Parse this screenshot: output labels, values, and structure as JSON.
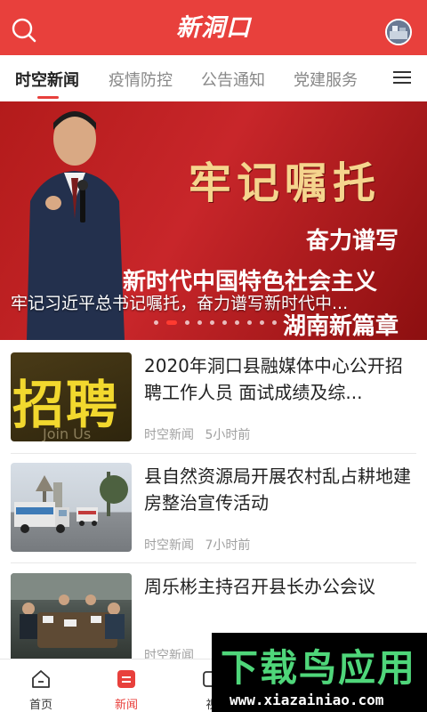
{
  "header": {
    "logo": "新洞口",
    "search_icon": "search-icon",
    "avatar_icon": "avatar"
  },
  "tabs": [
    {
      "label": "时空新闻",
      "active": true
    },
    {
      "label": "疫情防控"
    },
    {
      "label": "公告通知"
    },
    {
      "label": "党建服务"
    }
  ],
  "banner": {
    "headline": "牢记嘱托",
    "subline": "奋力谱写",
    "line2": "新时代中国特色社会主义",
    "line3": "湖南新篇章",
    "caption": "牢记习近平总书记嘱托，奋力谱写新时代中...",
    "dot_count": 10,
    "active_dot": 1
  },
  "news": [
    {
      "title": "2020年洞口县融媒体中心公开招聘工作人员 面试成绩及综...",
      "source": "时空新闻",
      "time": "5小时前",
      "thumb_text": "招聘",
      "thumb_sub": "Join Us"
    },
    {
      "title": "县自然资源局开展农村乱占耕地建房整治宣传活动",
      "source": "时空新闻",
      "time": "7小时前"
    },
    {
      "title": "周乐彬主持召开县长办公会议",
      "source": "时空新闻",
      "time": ""
    }
  ],
  "bottom_nav": [
    {
      "label": "首页",
      "icon": "home-icon"
    },
    {
      "label": "新闻",
      "icon": "news-icon",
      "active": true
    },
    {
      "label": "视",
      "icon": "video-icon"
    }
  ],
  "watermark": {
    "title": "下载鸟应用",
    "url": "www.xiazainiao.com"
  },
  "colors": {
    "brand": "#e8403c",
    "text": "#222222",
    "meta": "#a0a0a0"
  }
}
